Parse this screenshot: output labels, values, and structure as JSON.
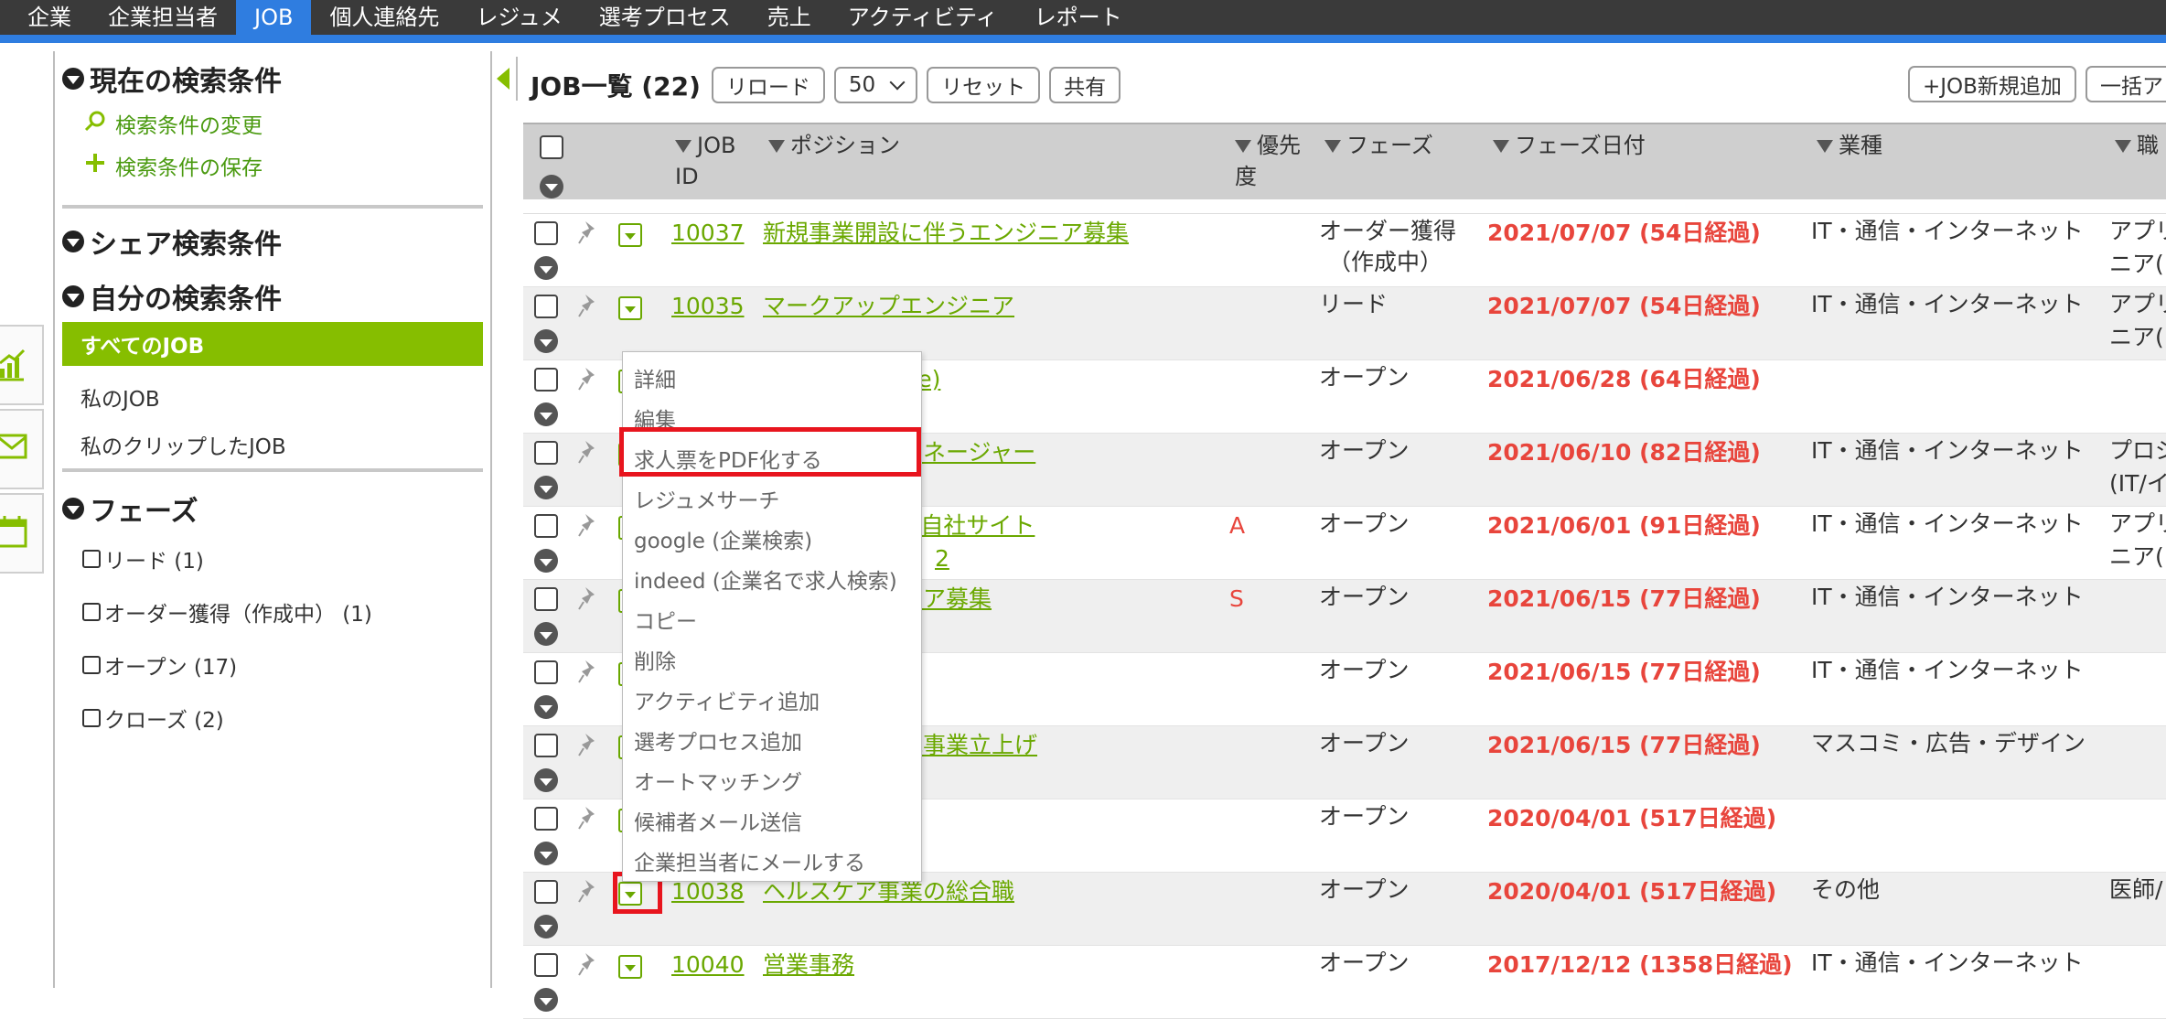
{
  "nav": [
    "企業",
    "企業担当者",
    "JOB",
    "個人連絡先",
    "レジュメ",
    "選考プロセス",
    "売上",
    "アクティビティ",
    "レポート"
  ],
  "nav_active_index": 2,
  "sidebar": {
    "current_conditions": "現在の検索条件",
    "change_conditions": "検索条件の変更",
    "save_conditions": "検索条件の保存",
    "shared_conditions": "シェア検索条件",
    "my_conditions": "自分の検索条件",
    "items": [
      "すべてのJOB",
      "私のJOB",
      "私のクリップしたJOB"
    ],
    "phase_title": "フェーズ",
    "phases": [
      "リード (1)",
      "オーダー獲得（作成中） (1)",
      "オープン (17)",
      "クローズ (2)"
    ]
  },
  "toolbar": {
    "title": "JOB一覧 (22)",
    "reload": "リロード",
    "per_page": "50",
    "reset": "リセット",
    "share": "共有",
    "add_job": "+JOB新規追加",
    "bulk": "一括ア"
  },
  "table": {
    "headers": {
      "job_id": "JOB",
      "job_id2": "ID",
      "position": "ポジション",
      "priority": "優先",
      "priority2": "度",
      "phase": "フェーズ",
      "phase_date": "フェーズ日付",
      "industry": "業種",
      "job_type": "職"
    },
    "rows": [
      {
        "id": "10037",
        "pos": "新規事業開設に伴うエンジニア募集",
        "pos2": "",
        "pri": "",
        "phase": "オーダー獲得",
        "phase2": "（作成中）",
        "date": "2021/07/07 (54日経過)",
        "ind": "IT・通信・インターネット",
        "job": "アプリ",
        "job2": "ニア("
      },
      {
        "id": "10035",
        "pos": "マークアップエンジニア",
        "pos2": "",
        "pri": "",
        "phase": "リード",
        "phase2": "",
        "date": "2021/07/07 (54日経過)",
        "ind": "IT・通信・インターネット",
        "job": "アプリ",
        "job2": "ニア("
      },
      {
        "id": "",
        "pos": "er (health care)",
        "pos2": "",
        "pri": "",
        "phase": "オープン",
        "phase2": "",
        "date": "2021/06/28 (64日経過)",
        "ind": "",
        "job": "",
        "job2": ""
      },
      {
        "id": "",
        "pos": "プロジェクトマネージャー",
        "pos2": "",
        "pri": "",
        "phase": "オープン",
        "phase2": "",
        "date": "2021/06/10 (82日経過)",
        "ind": "IT・通信・インターネット",
        "job": "プロジ",
        "job2": "(IT/イ"
      },
      {
        "id": "",
        "pos": "ー兼コーダー☆自社サイト",
        "pos2": "2",
        "pri": "A",
        "phase": "オープン",
        "phase2": "",
        "date": "2021/06/01 (91日経過)",
        "ind": "IT・通信・インターネット",
        "job": "アプリ",
        "job2": "ニア("
      },
      {
        "id": "",
        "pos": "に伴うエンジニア募集",
        "pos2": "",
        "pri": "S",
        "phase": "オープン",
        "phase2": "",
        "date": "2021/06/15 (77日経過)",
        "ind": "IT・通信・インターネット",
        "job": "",
        "job2": ""
      },
      {
        "id": "",
        "pos": "",
        "pos2": "",
        "pri": "",
        "phase": "オープン",
        "phase2": "",
        "date": "2021/06/15 (77日経過)",
        "ind": "IT・通信・インターネット",
        "job": "",
        "job2": ""
      },
      {
        "id": "",
        "pos": "ッフ募集！新規事業立上げ",
        "pos2": "",
        "pri": "",
        "phase": "オープン",
        "phase2": "",
        "date": "2021/06/15 (77日経過)",
        "ind": "マスコミ・広告・デザイン",
        "job": "",
        "job2": ""
      },
      {
        "id": "",
        "pos": "",
        "pos2": "",
        "pri": "",
        "phase": "オープン",
        "phase2": "",
        "date": "2020/04/01 (517日経過)",
        "ind": "",
        "job": "",
        "job2": ""
      },
      {
        "id": "10038",
        "pos": "ヘルスケア事業の総合職",
        "pos2": "",
        "pri": "",
        "phase": "オープン",
        "phase2": "",
        "date": "2020/04/01 (517日経過)",
        "ind": "その他",
        "job": "医師/",
        "job2": ""
      },
      {
        "id": "10040",
        "pos": "営業事務",
        "pos2": "",
        "pri": "",
        "phase": "オープン",
        "phase2": "",
        "date": "2017/12/12 (1358日経過)",
        "ind": "IT・通信・インターネット",
        "job": "",
        "job2": ""
      }
    ]
  },
  "context_menu": [
    "詳細",
    "編集",
    "求人票をPDF化する",
    "レジュメサーチ",
    "google (企業検索)",
    "indeed (企業名で求人検索)",
    "コピー",
    "削除",
    "アクティビティ追加",
    "選考プロセス追加",
    "オートマッチング",
    "候補者メール送信",
    "企業担当者にメールする"
  ],
  "colors": {
    "accent_green": "#86be00",
    "nav_blue": "#2f7de0",
    "date_red": "#e8453c",
    "highlight_red": "#e8151e"
  }
}
